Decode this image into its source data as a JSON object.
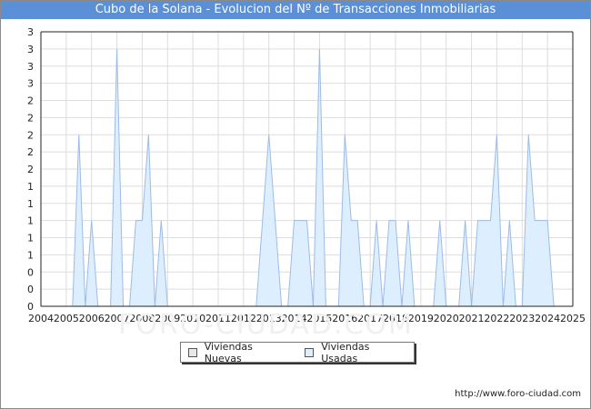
{
  "chart_data": {
    "type": "area",
    "title": "Cubo de la Solana - Evolucion del Nº de Transacciones Inmobiliarias",
    "xlabel": "",
    "ylabel": "",
    "x_tick_labels": [
      "2004",
      "2005",
      "2006",
      "2007",
      "2008",
      "2009",
      "2010",
      "2011",
      "2012",
      "2013",
      "2014",
      "2015",
      "2016",
      "2017",
      "2018",
      "2019",
      "2020",
      "2021",
      "2022",
      "2023",
      "2024",
      "2025"
    ],
    "y_tick_labels": [
      "0",
      "0",
      "0",
      "1",
      "1",
      "1",
      "1",
      "1",
      "2",
      "2",
      "2",
      "2",
      "2",
      "3",
      "3",
      "3",
      "3"
    ],
    "ylim": [
      0,
      3.2
    ],
    "xlim": [
      2004,
      2025
    ],
    "grid": true,
    "legend_position": "bottom-center",
    "series": [
      {
        "name": "Viviendas Nuevas",
        "color": "#e8e8e8",
        "values": []
      },
      {
        "name": "Viviendas Usadas",
        "color": "#ddeeff",
        "stroke": "#9dbbe8",
        "values": [
          [
            2005.25,
            0
          ],
          [
            2005.5,
            2
          ],
          [
            2005.75,
            0
          ],
          [
            2006.0,
            1
          ],
          [
            2006.25,
            0
          ],
          [
            2006.5,
            0
          ],
          [
            2006.75,
            0
          ],
          [
            2007.0,
            3
          ],
          [
            2007.25,
            0
          ],
          [
            2007.5,
            0
          ],
          [
            2007.75,
            1
          ],
          [
            2008.0,
            1
          ],
          [
            2008.25,
            2
          ],
          [
            2008.5,
            0
          ],
          [
            2008.75,
            1
          ],
          [
            2009.0,
            0
          ],
          [
            2012.5,
            0
          ],
          [
            2013.0,
            2
          ],
          [
            2013.5,
            0
          ],
          [
            2013.75,
            0
          ],
          [
            2014.0,
            1
          ],
          [
            2014.5,
            1
          ],
          [
            2014.75,
            0
          ],
          [
            2015.0,
            3
          ],
          [
            2015.25,
            0
          ],
          [
            2015.75,
            0
          ],
          [
            2016.0,
            2
          ],
          [
            2016.25,
            1
          ],
          [
            2016.5,
            1
          ],
          [
            2016.75,
            0
          ],
          [
            2017.0,
            0
          ],
          [
            2017.25,
            1
          ],
          [
            2017.5,
            0
          ],
          [
            2017.75,
            1
          ],
          [
            2018.0,
            1
          ],
          [
            2018.25,
            0
          ],
          [
            2018.5,
            1
          ],
          [
            2018.75,
            0
          ],
          [
            2019.5,
            0
          ],
          [
            2019.75,
            1
          ],
          [
            2020.0,
            0
          ],
          [
            2020.5,
            0
          ],
          [
            2020.75,
            1
          ],
          [
            2021.0,
            0
          ],
          [
            2021.25,
            1
          ],
          [
            2021.5,
            1
          ],
          [
            2021.75,
            1
          ],
          [
            2022.0,
            2
          ],
          [
            2022.25,
            0
          ],
          [
            2022.5,
            1
          ],
          [
            2022.75,
            0
          ],
          [
            2023.0,
            0
          ],
          [
            2023.25,
            2
          ],
          [
            2023.5,
            1
          ],
          [
            2023.75,
            1
          ],
          [
            2024.0,
            1
          ],
          [
            2024.25,
            0
          ]
        ]
      }
    ]
  },
  "watermark": "FORO-CIUDAD.COM",
  "source": "http://www.foro-ciudad.com"
}
